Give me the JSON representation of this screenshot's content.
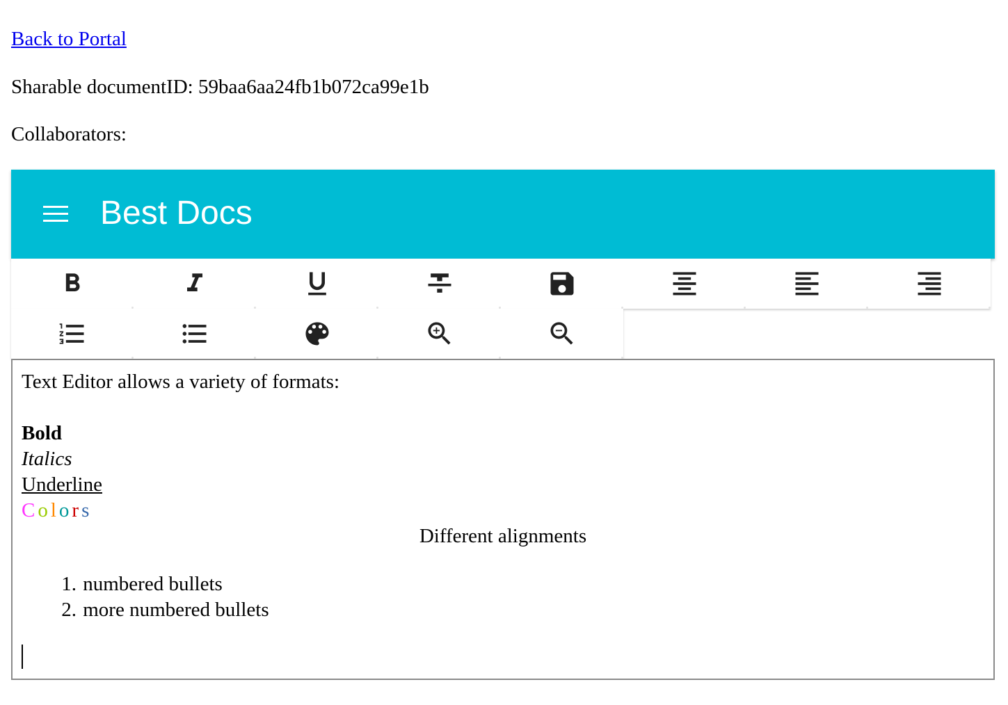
{
  "top": {
    "back_link": "Back to Portal",
    "doc_id_label": "Sharable documentID:",
    "doc_id_value": "59baa6aa24fb1b072ca99e1b",
    "collaborators_label": "Collaborators:"
  },
  "appbar": {
    "title": "Best Docs",
    "color": "#00bcd4",
    "menu_icon": "menu-icon"
  },
  "toolbar": {
    "row1": [
      "bold-icon",
      "italic-icon",
      "underline-icon",
      "strikethrough-icon",
      "save-icon",
      "align-center-icon",
      "align-left-icon",
      "align-right-icon"
    ],
    "row2": [
      "numbered-list-icon",
      "bulleted-list-icon",
      "palette-icon",
      "zoom-in-icon",
      "zoom-out-icon"
    ]
  },
  "editor": {
    "intro": "Text Editor allows a variety of formats:",
    "bold": "Bold",
    "italic": "Italics",
    "underline": "Underline",
    "colors": [
      {
        "letter": "C",
        "color": "#ff33ff"
      },
      {
        "letter": "o",
        "color": "#99cc00"
      },
      {
        "letter": "l",
        "color": "#ff8800"
      },
      {
        "letter": "o",
        "color": "#009999"
      },
      {
        "letter": "r",
        "color": "#cc0000"
      },
      {
        "letter": "s",
        "color": "#3366aa"
      }
    ],
    "centered": "Different alignments",
    "list": [
      {
        "num": "1.",
        "text": "numbered bullets"
      },
      {
        "num": "2.",
        "text": "more numbered bullets"
      }
    ]
  }
}
